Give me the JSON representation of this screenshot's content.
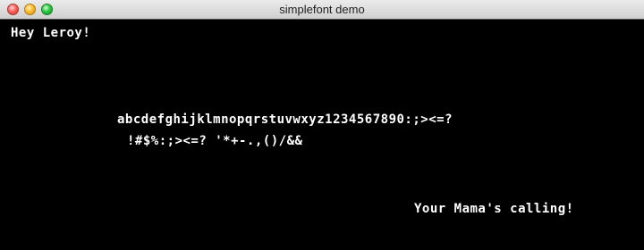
{
  "window": {
    "title": "simplefont demo"
  },
  "canvas": {
    "lines": {
      "greeting": "Hey Leroy!",
      "alphabet": "abcdefghijklmnopqrstuvwxyz1234567890:;><=?",
      "symbols": "!#$%:;><=? '*+-.,()/&&",
      "mama": "Your Mama's calling!"
    }
  },
  "colors": {
    "background": "#000000",
    "text": "#ffffff"
  }
}
